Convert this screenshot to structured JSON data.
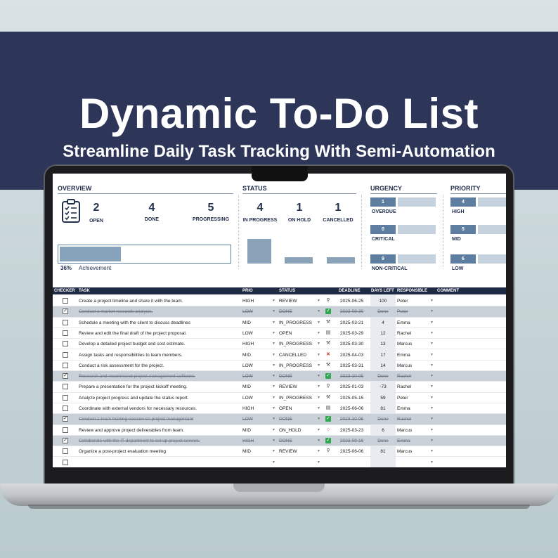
{
  "banner": {
    "title": "Dynamic To-Do List",
    "subtitle": "Streamline Daily Task Tracking With Semi-Automation"
  },
  "overview": {
    "title": "OVERVIEW",
    "open": {
      "value": "2",
      "label": "OPEN"
    },
    "done": {
      "value": "4",
      "label": "DONE"
    },
    "progressing": {
      "value": "5",
      "label": "PROGRESSING"
    },
    "achievement_pct": "36%",
    "achievement_label": "Achievement",
    "achievement_fraction": 0.36,
    "icon": "checklist-icon"
  },
  "status": {
    "title": "STATUS",
    "in_progress": {
      "value": "4",
      "label": "IN PROGRESS",
      "level": 1.0
    },
    "on_hold": {
      "value": "1",
      "label": "ON HOLD",
      "level": 0.25
    },
    "cancelled": {
      "value": "1",
      "label": "CANCELLED",
      "level": 0.25
    }
  },
  "urgency": {
    "title": "URGENCY",
    "overdue": {
      "value": "1",
      "label": "OVERDUE"
    },
    "critical": {
      "value": "0",
      "label": "CRITICAL"
    },
    "non_critical": {
      "value": "9",
      "label": "NON-CRITICAL"
    }
  },
  "priority": {
    "title": "PRIORITY",
    "high": {
      "value": "4",
      "label": "HIGH"
    },
    "mid": {
      "value": "5",
      "label": "MID"
    },
    "low": {
      "value": "6",
      "label": "LOW"
    }
  },
  "table": {
    "headers": {
      "checker": "CHECKER",
      "task": "TASK",
      "prio": "PRIO",
      "status": "STATUS",
      "deadline": "DEADLINE",
      "days_left": "DAYS LEFT",
      "responsible": "RESPONSIBLE",
      "comment": "COMMENT"
    },
    "rows": [
      {
        "checked": false,
        "done": false,
        "task": "Create a project timeline and share it with the team.",
        "prio": "HIGH",
        "status": "REVIEW",
        "icon": "magnifier-icon",
        "deadline": "2025-06-25",
        "days": "100",
        "resp": "Peter"
      },
      {
        "checked": true,
        "done": true,
        "task": "Conduct a market research analysis.",
        "prio": "LOW",
        "status": "DONE",
        "icon": "check-icon",
        "deadline": "2023-09-30",
        "days": "Done",
        "resp": "Peter"
      },
      {
        "checked": false,
        "done": false,
        "task": "Schedule a meeting with the client to discuss deadlines",
        "prio": "MID",
        "status": "IN_PROGRESS",
        "icon": "tools-icon",
        "deadline": "2025-03-21",
        "days": "4",
        "resp": "Emma"
      },
      {
        "checked": false,
        "done": false,
        "task": "Review and edit the final draft of the project proposal.",
        "prio": "LOW",
        "status": "OPEN",
        "icon": "document-icon",
        "deadline": "2025-03-29",
        "days": "12",
        "resp": "Rachel"
      },
      {
        "checked": false,
        "done": false,
        "task": "Develop a detailed project budget and cost estimate.",
        "prio": "HIGH",
        "status": "IN_PROGRESS",
        "icon": "tools-icon",
        "deadline": "2025-03-30",
        "days": "13",
        "resp": "Marcus"
      },
      {
        "checked": false,
        "done": false,
        "task": "Assign tasks and responsibilities to team members.",
        "prio": "MID",
        "status": "CANCELLED",
        "icon": "cross-icon",
        "deadline": "2025-04-03",
        "days": "17",
        "resp": "Emma"
      },
      {
        "checked": false,
        "done": false,
        "task": "Conduct a risk assessment for the project.",
        "prio": "LOW",
        "status": "IN_PROGRESS",
        "icon": "tools-icon",
        "deadline": "2025-03-31",
        "days": "14",
        "resp": "Marcus"
      },
      {
        "checked": true,
        "done": true,
        "task": "Research and recommend project management software.",
        "prio": "LOW",
        "status": "DONE",
        "icon": "check-icon",
        "deadline": "2023-10-05",
        "days": "Done",
        "resp": "Rachel"
      },
      {
        "checked": false,
        "done": false,
        "task": "Prepare a presentation for the project kickoff meeting.",
        "prio": "MID",
        "status": "REVIEW",
        "icon": "magnifier-icon",
        "deadline": "2025-01-03",
        "days": "-73",
        "resp": "Rachel"
      },
      {
        "checked": false,
        "done": false,
        "task": "Analyze project progress and update the status report.",
        "prio": "LOW",
        "status": "IN_PROGRESS",
        "icon": "tools-icon",
        "deadline": "2025-05-15",
        "days": "59",
        "resp": "Peter"
      },
      {
        "checked": false,
        "done": false,
        "task": "Coordinate with external vendors for necessary resources.",
        "prio": "HIGH",
        "status": "OPEN",
        "icon": "document-icon",
        "deadline": "2025-06-06",
        "days": "81",
        "resp": "Emma"
      },
      {
        "checked": true,
        "done": true,
        "task": "Conduct a team training session on project management",
        "prio": "LOW",
        "status": "DONE",
        "icon": "check-icon",
        "deadline": "2023-10-05",
        "days": "Done",
        "resp": "Rachel"
      },
      {
        "checked": false,
        "done": false,
        "task": "Review and approve project deliverables from team.",
        "prio": "MID",
        "status": "ON_HOLD",
        "icon": "circle-icon",
        "deadline": "2025-03-23",
        "days": "6",
        "resp": "Marcus"
      },
      {
        "checked": true,
        "done": true,
        "task": "Collaborate with the IT department to set up project servers.",
        "prio": "HIGH",
        "status": "DONE",
        "icon": "check-icon",
        "deadline": "2023-09-19",
        "days": "Done",
        "resp": "Emma"
      },
      {
        "checked": false,
        "done": false,
        "task": "Organize a post-project evaluation meeting",
        "prio": "MID",
        "status": "REVIEW",
        "icon": "magnifier-icon",
        "deadline": "2025-06-06",
        "days": "81",
        "resp": "Marcus"
      },
      {
        "checked": false,
        "done": false,
        "task": "",
        "prio": "",
        "status": "",
        "icon": "",
        "deadline": "",
        "days": "",
        "resp": ""
      }
    ]
  },
  "colors": {
    "banner": "#2d3558",
    "accent": "#5d7ea1",
    "bar": "#8aa3b8",
    "header": "#1f2a44",
    "done_row": "#c9d0d7"
  }
}
